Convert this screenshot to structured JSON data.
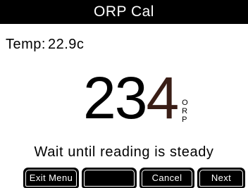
{
  "title": "ORP Cal",
  "temperature": {
    "label": "Temp:",
    "value": "22.9c"
  },
  "reading": {
    "digits_main": "23",
    "digit_last": "4",
    "unit_letters": [
      "O",
      "R",
      "P"
    ]
  },
  "status_message": "Wait until reading is steady",
  "softkeys": [
    {
      "label": "Exit Menu"
    },
    {
      "label": ""
    },
    {
      "label": "Cancel"
    },
    {
      "label": "Next"
    }
  ],
  "colors": {
    "title_bar": "#000000",
    "background": "#ffffff",
    "last_digit": "#3a1e16"
  }
}
